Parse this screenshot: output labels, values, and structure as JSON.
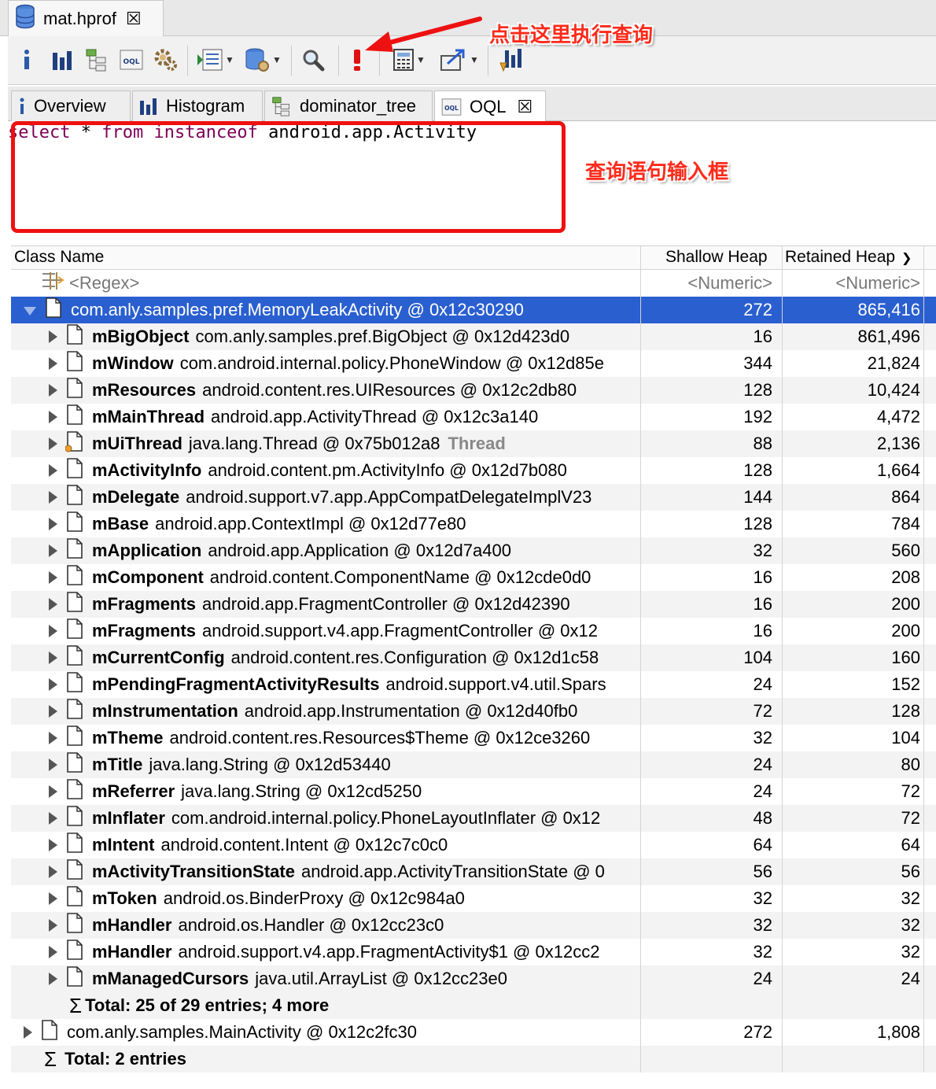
{
  "editor_tab": {
    "title": "mat.hprof",
    "close": "☒"
  },
  "toolbar": {
    "icons": [
      "info-icon",
      "histogram-icon",
      "dominator-tree-icon",
      "oql-icon",
      "gear-icon",
      "query-browser-icon",
      "heap-dump-icon",
      "search-icon",
      "execute-query-icon",
      "calculator-icon",
      "export-icon",
      "pin-icon"
    ]
  },
  "tabs": [
    {
      "label": "Overview"
    },
    {
      "label": "Histogram"
    },
    {
      "label": "dominator_tree"
    },
    {
      "label": "OQL",
      "close": "☒"
    }
  ],
  "query": {
    "kw1": "select",
    "mid1": " * ",
    "kw2": "from",
    "mid2": " ",
    "kw3": "instanceof",
    "rest": " android.app.Activity"
  },
  "annotations": {
    "execute_hint": "点击这里执行查询",
    "input_hint": "查询语句输入框"
  },
  "table": {
    "columns": {
      "class_name": "Class Name",
      "shallow": "Shallow Heap",
      "retained": "Retained Heap"
    },
    "filter": {
      "regex": "<Regex>",
      "shallow": "<Numeric>",
      "retained": "<Numeric>"
    },
    "root1": {
      "name": "com.anly.samples.pref.MemoryLeakActivity @ 0x12c30290",
      "shallow": "272",
      "retained": "865,416"
    },
    "children": [
      {
        "field": "mBigObject",
        "obj": "com.anly.samples.pref.BigObject @ 0x12d423d0",
        "shallow": "16",
        "retained": "861,496"
      },
      {
        "field": "mWindow",
        "obj": "com.android.internal.policy.PhoneWindow @ 0x12d85e",
        "shallow": "344",
        "retained": "21,824"
      },
      {
        "field": "mResources",
        "obj": "android.content.res.UIResources @ 0x12c2db80",
        "shallow": "128",
        "retained": "10,424"
      },
      {
        "field": "mMainThread",
        "obj": "android.app.ActivityThread @ 0x12c3a140",
        "shallow": "192",
        "retained": "4,472"
      },
      {
        "field": "mUiThread",
        "obj": "java.lang.Thread @ 0x75b012a8",
        "tag": "Thread",
        "shallow": "88",
        "retained": "2,136"
      },
      {
        "field": "mActivityInfo",
        "obj": "android.content.pm.ActivityInfo @ 0x12d7b080",
        "shallow": "128",
        "retained": "1,664"
      },
      {
        "field": "mDelegate",
        "obj": "android.support.v7.app.AppCompatDelegateImplV23",
        "shallow": "144",
        "retained": "864"
      },
      {
        "field": "mBase",
        "obj": "android.app.ContextImpl @ 0x12d77e80",
        "shallow": "128",
        "retained": "784"
      },
      {
        "field": "mApplication",
        "obj": "android.app.Application @ 0x12d7a400",
        "shallow": "32",
        "retained": "560"
      },
      {
        "field": "mComponent",
        "obj": "android.content.ComponentName @ 0x12cde0d0",
        "shallow": "16",
        "retained": "208"
      },
      {
        "field": "mFragments",
        "obj": "android.app.FragmentController @ 0x12d42390",
        "shallow": "16",
        "retained": "200"
      },
      {
        "field": "mFragments",
        "obj": "android.support.v4.app.FragmentController @ 0x12",
        "shallow": "16",
        "retained": "200"
      },
      {
        "field": "mCurrentConfig",
        "obj": "android.content.res.Configuration @ 0x12d1c58",
        "shallow": "104",
        "retained": "160"
      },
      {
        "field": "mPendingFragmentActivityResults",
        "obj": "android.support.v4.util.Spars",
        "shallow": "24",
        "retained": "152"
      },
      {
        "field": "mInstrumentation",
        "obj": "android.app.Instrumentation @ 0x12d40fb0",
        "shallow": "72",
        "retained": "128"
      },
      {
        "field": "mTheme",
        "obj": "android.content.res.Resources$Theme @ 0x12ce3260",
        "shallow": "32",
        "retained": "104"
      },
      {
        "field": "mTitle",
        "obj": "java.lang.String @ 0x12d53440",
        "shallow": "24",
        "retained": "80"
      },
      {
        "field": "mReferrer",
        "obj": "java.lang.String @ 0x12cd5250",
        "shallow": "24",
        "retained": "72"
      },
      {
        "field": "mInflater",
        "obj": "com.android.internal.policy.PhoneLayoutInflater @ 0x12",
        "shallow": "48",
        "retained": "72"
      },
      {
        "field": "mIntent",
        "obj": "android.content.Intent @ 0x12c7c0c0",
        "shallow": "64",
        "retained": "64"
      },
      {
        "field": "mActivityTransitionState",
        "obj": "android.app.ActivityTransitionState @ 0",
        "shallow": "56",
        "retained": "56"
      },
      {
        "field": "mToken",
        "obj": "android.os.BinderProxy @ 0x12c984a0",
        "shallow": "32",
        "retained": "32"
      },
      {
        "field": "mHandler",
        "obj": "android.os.Handler @ 0x12cc23c0",
        "shallow": "32",
        "retained": "32"
      },
      {
        "field": "mHandler",
        "obj": "android.support.v4.app.FragmentActivity$1 @ 0x12cc2",
        "shallow": "32",
        "retained": "32"
      },
      {
        "field": "mManagedCursors",
        "obj": "java.util.ArrayList @ 0x12cc23e0",
        "shallow": "24",
        "retained": "24"
      }
    ],
    "child_total": "Total: 25 of 29 entries; 4 more",
    "root2": {
      "name": "com.anly.samples.MainActivity @ 0x12c2fc30",
      "shallow": "272",
      "retained": "1,808"
    },
    "grand_total": "Total: 2 entries"
  }
}
